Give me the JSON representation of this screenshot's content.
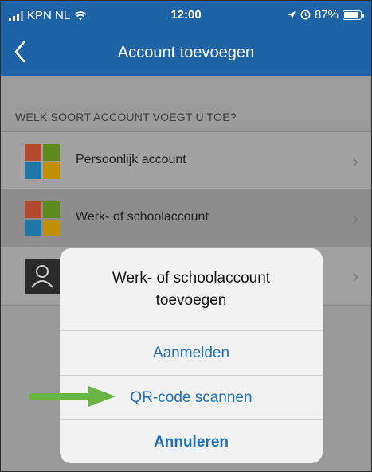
{
  "status_bar": {
    "carrier": "KPN NL",
    "time": "12:00",
    "battery": "87%",
    "icons": [
      "signal-icon",
      "wifi-icon",
      "location-icon",
      "alarm-icon",
      "battery-icon"
    ]
  },
  "nav": {
    "back_icon": "chevron-left-icon",
    "title": "Account toevoegen"
  },
  "section": {
    "header": "WELK SOORT ACCOUNT VOEGT U TOE?",
    "items": [
      {
        "label": "Persoonlijk account",
        "icon": "microsoft-logo-icon"
      },
      {
        "label": "Werk- of schoolaccount",
        "icon": "microsoft-logo-icon"
      },
      {
        "label": "",
        "icon": "person-icon"
      }
    ]
  },
  "sheet": {
    "title": "Werk- of schoolaccount toevoegen",
    "options": [
      "Aanmelden",
      "QR-code scannen"
    ],
    "cancel": "Annuleren"
  },
  "colors": {
    "nav_blue": "#1e63a6",
    "action_blue": "#1f6fb8",
    "arrow_green": "#6ab443"
  }
}
